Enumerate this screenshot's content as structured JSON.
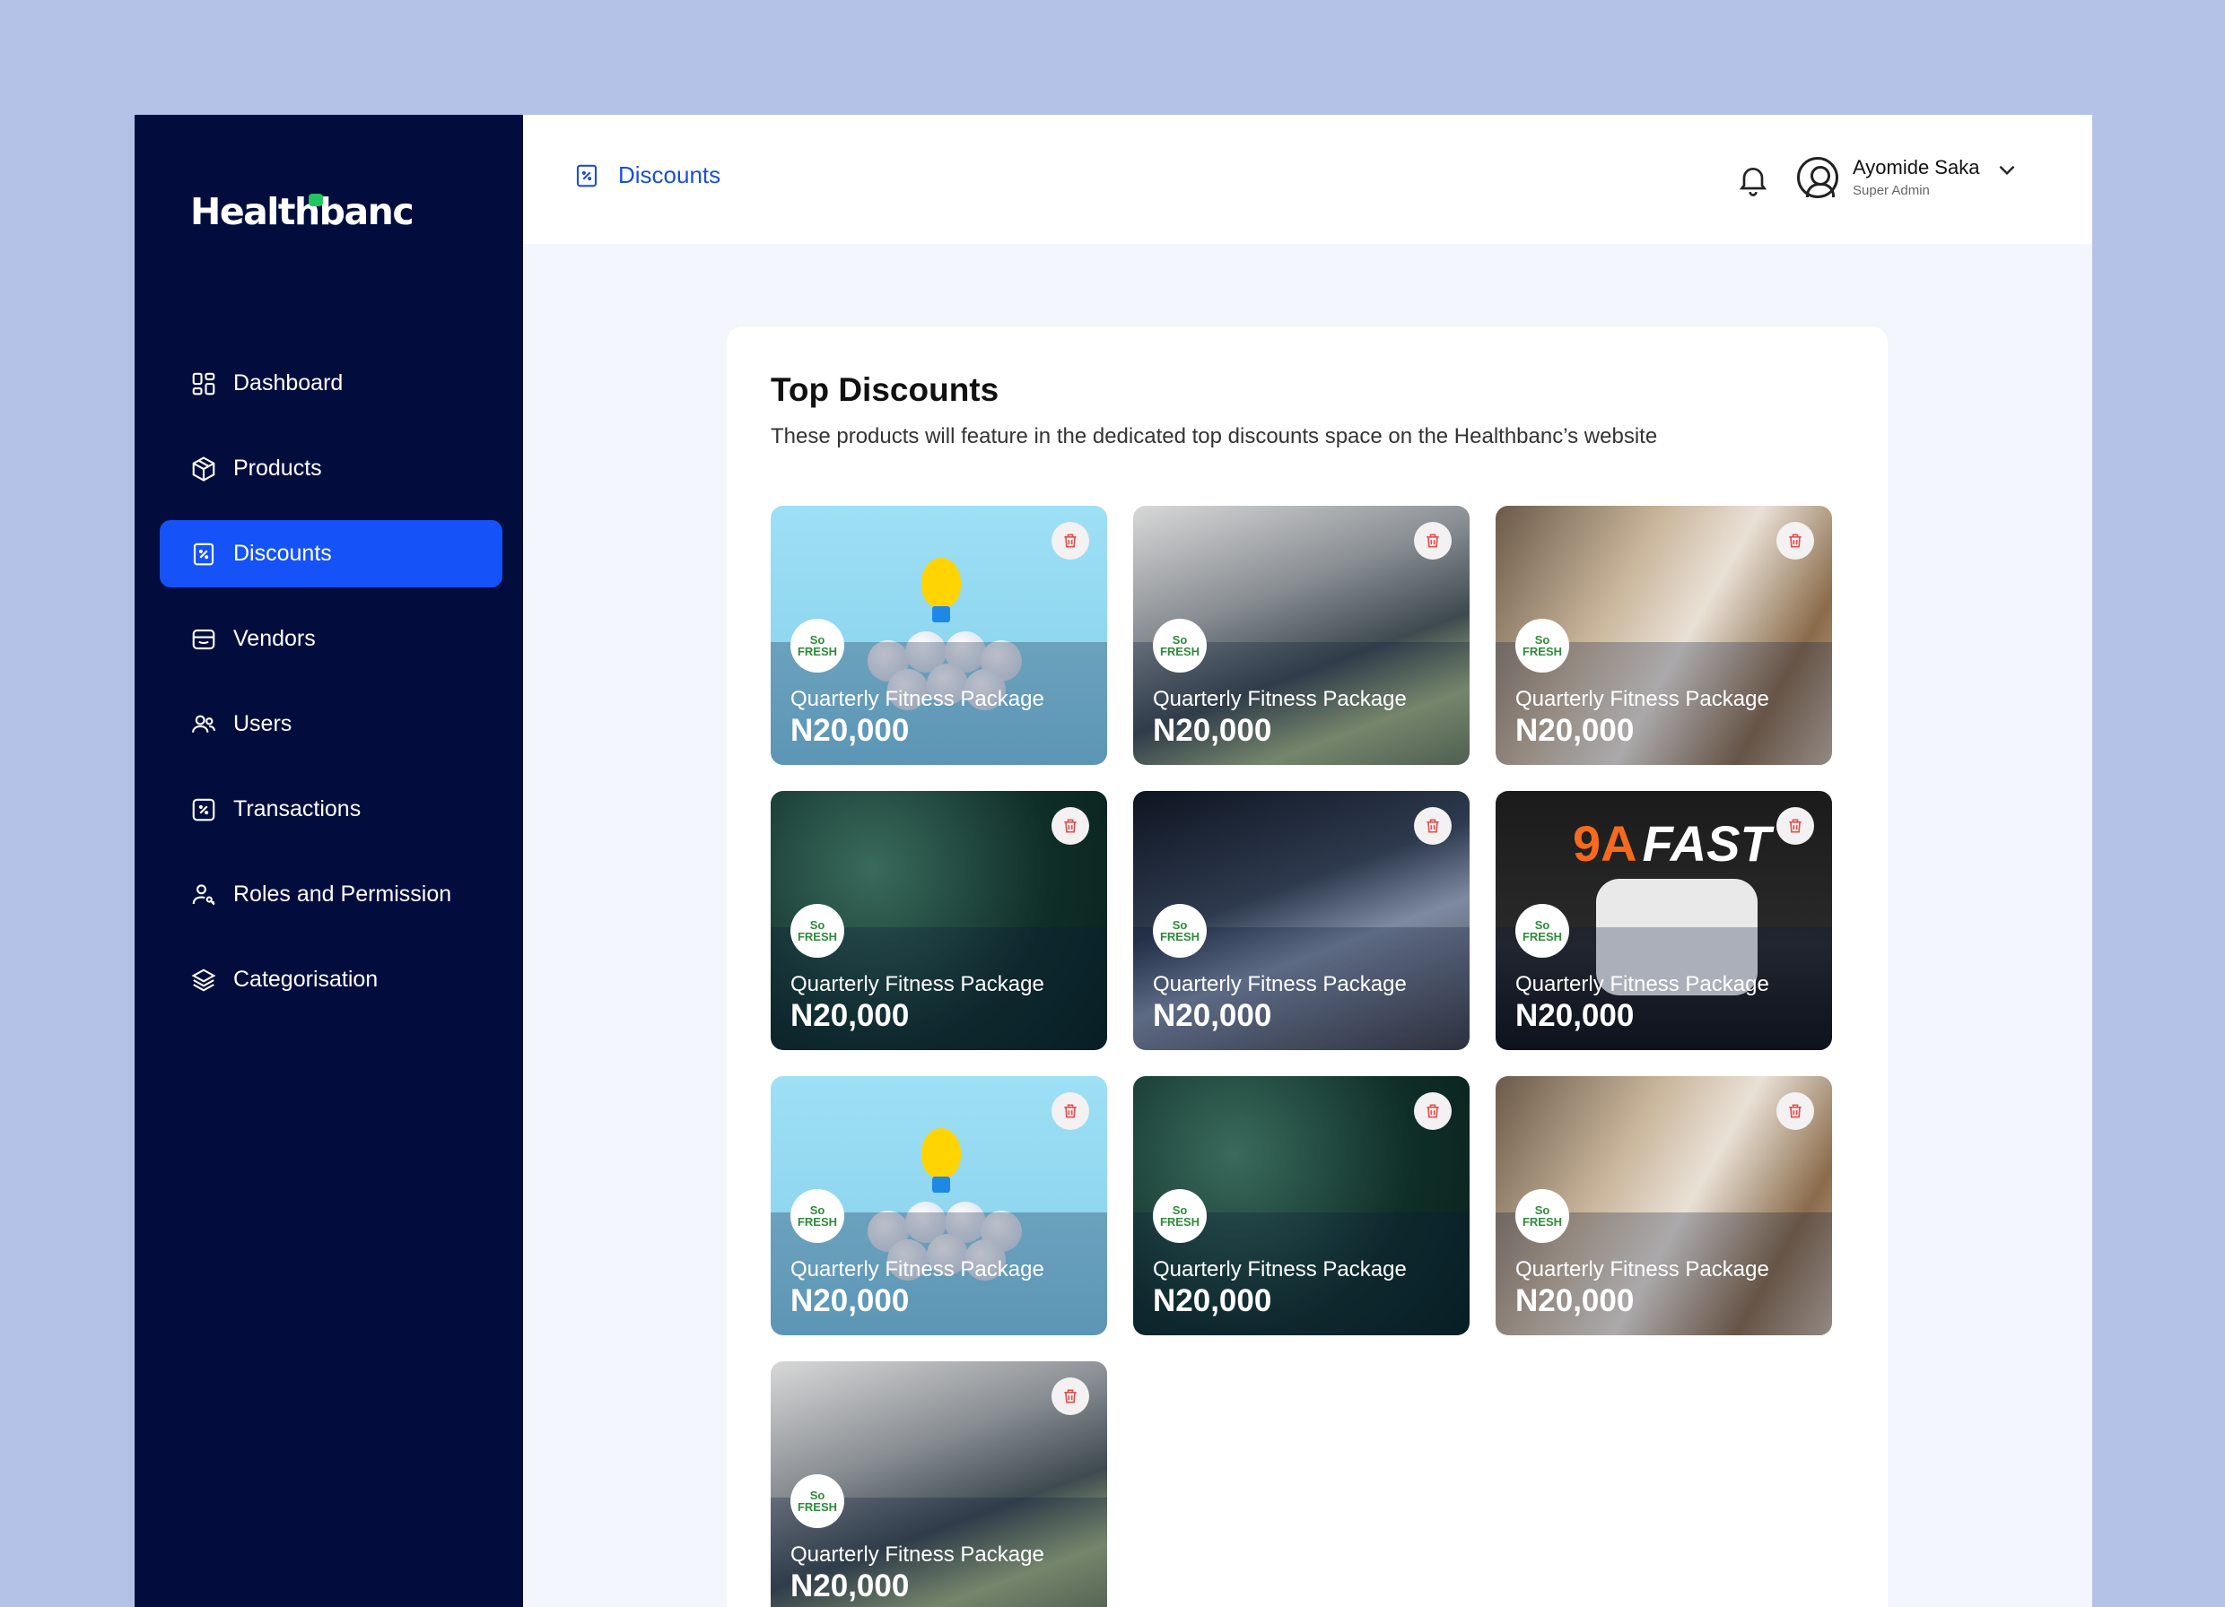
{
  "app": {
    "logo_text": "Healthbanc"
  },
  "sidebar": {
    "items": [
      {
        "label": "Dashboard",
        "icon": "dashboard-icon",
        "active": false
      },
      {
        "label": "Products",
        "icon": "box-icon",
        "active": false
      },
      {
        "label": "Discounts",
        "icon": "discount-icon",
        "active": true
      },
      {
        "label": "Vendors",
        "icon": "store-icon",
        "active": false
      },
      {
        "label": "Users",
        "icon": "users-icon",
        "active": false
      },
      {
        "label": "Transactions",
        "icon": "transaction-icon",
        "active": false
      },
      {
        "label": "Roles and Permission",
        "icon": "user-key-icon",
        "active": false
      },
      {
        "label": "Categorisation",
        "icon": "layers-icon",
        "active": false
      }
    ]
  },
  "header": {
    "breadcrumb": "Discounts",
    "user": {
      "name": "Ayomide Saka",
      "role": "Super Admin"
    }
  },
  "main": {
    "title": "Top Discounts",
    "description": "These products will feature in the dedicated top discounts space on the Healthbanc’s website",
    "cards": [
      {
        "title": "Quarterly Fitness Package",
        "price": "N20,000",
        "image": "bulb"
      },
      {
        "title": "Quarterly Fitness Package",
        "price": "N20,000",
        "image": "hospital"
      },
      {
        "title": "Quarterly Fitness Package",
        "price": "N20,000",
        "image": "woman"
      },
      {
        "title": "Quarterly Fitness Package",
        "price": "N20,000",
        "image": "leaves"
      },
      {
        "title": "Quarterly Fitness Package",
        "price": "N20,000",
        "image": "dark"
      },
      {
        "title": "Quarterly Fitness Package",
        "price": "N20,000",
        "image": "fast"
      },
      {
        "title": "Quarterly Fitness Package",
        "price": "N20,000",
        "image": "bulb"
      },
      {
        "title": "Quarterly Fitness Package",
        "price": "N20,000",
        "image": "leaves"
      },
      {
        "title": "Quarterly Fitness Package",
        "price": "N20,000",
        "image": "woman"
      },
      {
        "title": "Quarterly Fitness Package",
        "price": "N20,000",
        "image": "hospital"
      }
    ],
    "vendor_logo_text": "So FRESH",
    "fast_banner_text": "FAST",
    "fast_banner_brand": "9A"
  },
  "colors": {
    "page_bg": "#b4c2e8",
    "sidebar_bg": "#020d3e",
    "accent": "#1552f7",
    "delete_icon": "#e0504f"
  }
}
